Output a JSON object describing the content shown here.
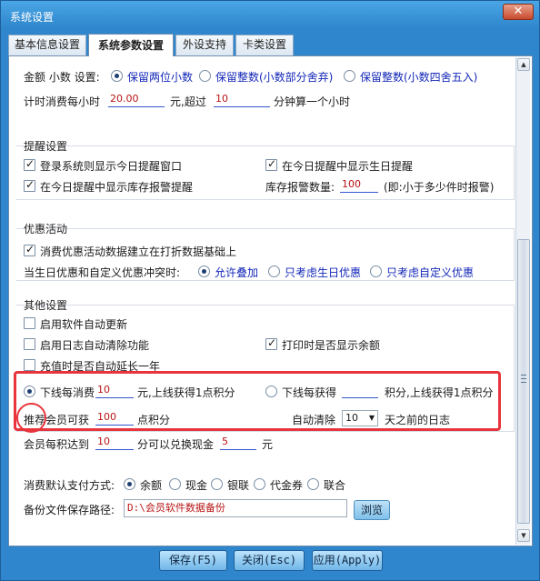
{
  "window": {
    "title": "系统设置",
    "close_glyph": "✕"
  },
  "tabs": [
    {
      "label": "基本信息设置"
    },
    {
      "label": "系统参数设置"
    },
    {
      "label": "外设支持"
    },
    {
      "label": "卡类设置"
    }
  ],
  "amount": {
    "label": "金额 小数 设置:",
    "options": [
      "保留两位小数",
      "保留整数(小数部分舍弃)",
      "保留整数(小数四舍五入)"
    ],
    "selected": "保留两位小数"
  },
  "timing": {
    "label": "计时消费每小时",
    "price": "20.00",
    "mid": "元,超过",
    "minutes": "10",
    "suffix": "分钟算一个小时"
  },
  "reminder": {
    "title": "提醒设置",
    "login_popup": {
      "label": "登录系统则显示今日提醒窗口",
      "checked": true
    },
    "birthday": {
      "label": "在今日提醒中显示生日提醒",
      "checked": true
    },
    "stock_alert": {
      "label": "在今日提醒中显示库存报警提醒",
      "checked": true
    },
    "stock_qty_label": "库存报警数量:",
    "stock_qty": "100",
    "stock_hint": "(即:小于多少件时报警)"
  },
  "promo": {
    "title": "优惠活动",
    "base_on_discount": {
      "label": "消费优惠活动数据建立在打折数据基础上",
      "checked": true
    },
    "conflict_label": "当生日优惠和自定义优惠冲突时:",
    "options": [
      "允许叠加",
      "只考虑生日优惠",
      "只考虑自定义优惠"
    ],
    "selected": "允许叠加"
  },
  "other": {
    "title": "其他设置",
    "auto_update": {
      "label": "启用软件自动更新",
      "checked": false
    },
    "log_clean": {
      "label": "启用日志自动清除功能",
      "checked": false
    },
    "print_balance": {
      "label": "打印时是否显示余额",
      "checked": true
    },
    "recharge_extend": {
      "label": "充值时是否自动延长一年",
      "checked": false
    }
  },
  "points": {
    "per_spend_label": "下线每消费",
    "per_spend_value": "10",
    "per_spend_suffix": "元,上线获得1点积分",
    "per_gain_label": "下线每获得",
    "per_gain_value": "",
    "per_gain_suffix": "积分,上线获得1点积分",
    "selected": "per_spend",
    "referrer_label": "推荐会员可获",
    "referrer_value": "100",
    "referrer_suffix": "点积分",
    "auto_clean_label": "自动清除",
    "auto_clean_value": "10",
    "auto_clean_suffix": "天之前的日志"
  },
  "exchange": {
    "label": "会员每积达到",
    "points": "10",
    "mid": "分可以兑换现金",
    "cash": "5",
    "suffix": "元"
  },
  "payment": {
    "label": "消费默认支付方式:",
    "options": [
      "余额",
      "现金",
      "银联",
      "代金券",
      "联合"
    ],
    "selected": "余额"
  },
  "backup": {
    "label": "备份文件保存路径:",
    "path": "D:\\会员软件数据备份",
    "browse": "浏览"
  },
  "buttons": {
    "save": "保存(F5)",
    "close": "关闭(Esc)",
    "apply": "应用(Apply)"
  },
  "colors": {
    "highlight": "#e8343c",
    "link_blue": "#1428b8",
    "value_red": "#b81414"
  },
  "scroll": {
    "thumb_position_fraction": 0.4
  }
}
